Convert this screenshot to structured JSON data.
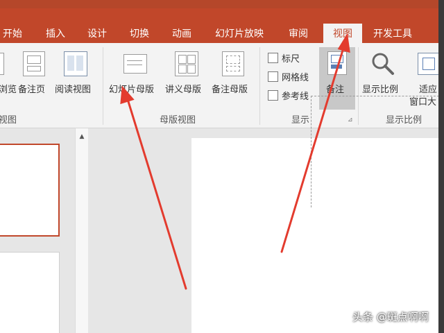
{
  "tabs": [
    {
      "label": "开始",
      "active": false
    },
    {
      "label": "插入",
      "active": false
    },
    {
      "label": "设计",
      "active": false
    },
    {
      "label": "切换",
      "active": false
    },
    {
      "label": "动画",
      "active": false
    },
    {
      "label": "幻灯片放映",
      "active": false
    },
    {
      "label": "审阅",
      "active": false
    },
    {
      "label": "视图",
      "active": true
    },
    {
      "label": "开发工具",
      "active": false
    }
  ],
  "ribbon": {
    "presentation_views": {
      "group_label": "视图",
      "buttons": [
        "浏览",
        "备注页",
        "阅读视图"
      ]
    },
    "master_views": {
      "group_label": "母版视图",
      "buttons": [
        "幻灯片母版",
        "讲义母版",
        "备注母版"
      ]
    },
    "show": {
      "group_label": "显示",
      "checkboxes": [
        {
          "label": "标尺",
          "checked": false
        },
        {
          "label": "网格线",
          "checked": false
        },
        {
          "label": "参考线",
          "checked": false
        }
      ],
      "notes_button": "备注"
    },
    "zoom": {
      "group_label": "显示比例",
      "buttons": [
        "显示比例",
        "适应",
        "窗口大"
      ]
    }
  },
  "watermark": "头条 @斑点啊啊",
  "colors": {
    "ribbon_tab_bar": "#c1472a",
    "arrow": "#e33b2e",
    "active_tab_bg": "#f3f3f3"
  }
}
